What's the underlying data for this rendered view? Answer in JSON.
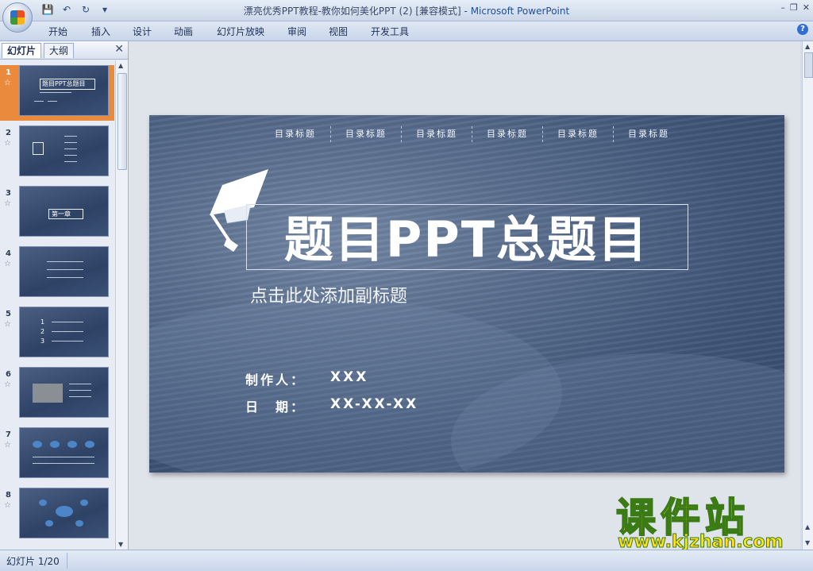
{
  "window": {
    "title": "漂亮优秀PPT教程-教你如何美化PPT (2) [兼容模式]",
    "app_suffix": "- Microsoft PowerPoint"
  },
  "ribbon": {
    "tabs": [
      "开始",
      "插入",
      "设计",
      "动画",
      "幻灯片放映",
      "审阅",
      "视图",
      "开发工具"
    ]
  },
  "panel": {
    "tab_slides": "幻灯片",
    "tab_outline": "大纲",
    "thumbnails": [
      {
        "num": "1"
      },
      {
        "num": "2"
      },
      {
        "num": "3"
      },
      {
        "num": "4"
      },
      {
        "num": "5"
      },
      {
        "num": "6"
      },
      {
        "num": "7"
      },
      {
        "num": "8"
      }
    ],
    "thumb1_title": "题目PPT总题目",
    "thumb3_title": "第一章",
    "thumb5_nums": [
      "1",
      "2",
      "3"
    ]
  },
  "slide": {
    "toc": [
      "目录标题",
      "目录标题",
      "目录标题",
      "目录标题",
      "目录标题",
      "目录标题"
    ],
    "title": "题目PPT总题目",
    "subtitle": "点击此处添加副标题",
    "author_label": "制作人：",
    "author_value": "XXX",
    "date_label": "日　期：",
    "date_value": "XX-XX-XX"
  },
  "status": {
    "slide_indicator": "幻灯片 1/20"
  },
  "watermark": {
    "brand": "课件站",
    "url": "www.kjzhan.com"
  },
  "colors": {
    "slide_bg": "#3f5578",
    "selection": "#e98a3c",
    "watermark_fill": "#ffe21a",
    "watermark_stroke": "#3a7b16"
  }
}
